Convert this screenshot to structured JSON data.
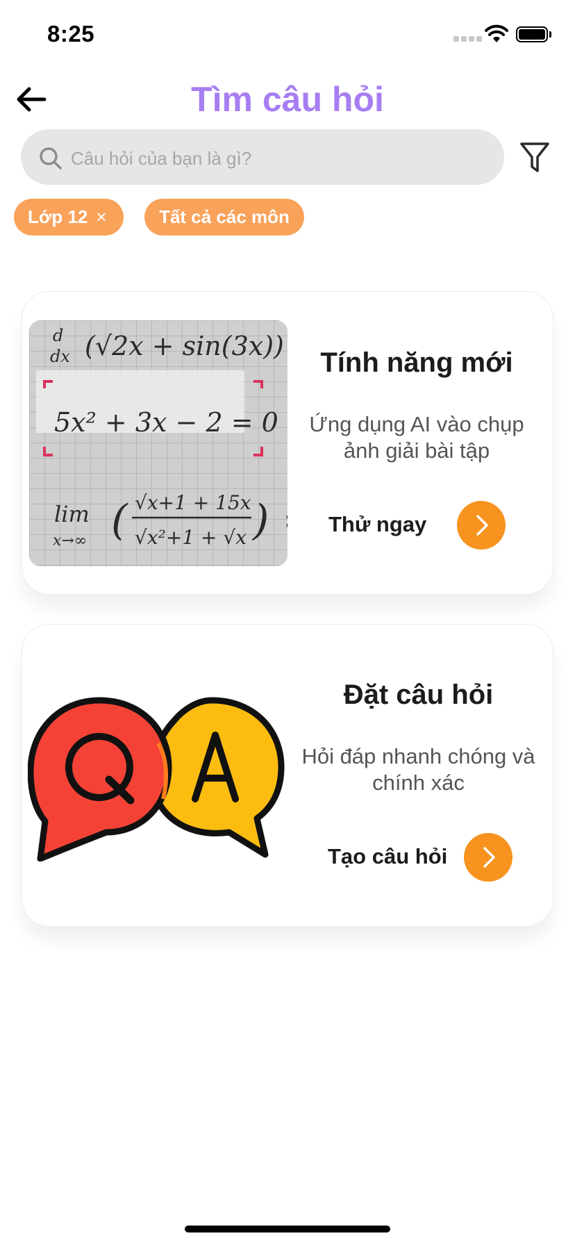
{
  "status_bar": {
    "time": "8:25"
  },
  "header": {
    "title": "Tìm câu hỏi"
  },
  "search": {
    "placeholder": "Câu hỏi của bạn là gì?"
  },
  "filters": {
    "grade_chip": {
      "label": "Lớp 12",
      "remove_symbol": "×"
    },
    "subject_chip": {
      "label": "Tất cả các môn"
    }
  },
  "cards": [
    {
      "title": "Tính năng mới",
      "description": "Ứng dụng AI vào chụp ảnh giải bài tập",
      "action_label": "Thử ngay",
      "image_icon": "math-equations-photo"
    },
    {
      "title": "Đặt câu hỏi",
      "description": "Hỏi đáp nhanh chóng và chính xác",
      "action_label": "Tạo câu hỏi",
      "image_icon": "qa-speech-bubbles",
      "image_text": {
        "q": "Q",
        "a": "A"
      }
    }
  ],
  "colors": {
    "title_purple": "#a77ef2",
    "chip_orange": "#f9a25a",
    "button_orange": "#f7931e",
    "q_bubble_red": "#f44336",
    "a_bubble_yellow": "#fdbd10"
  }
}
